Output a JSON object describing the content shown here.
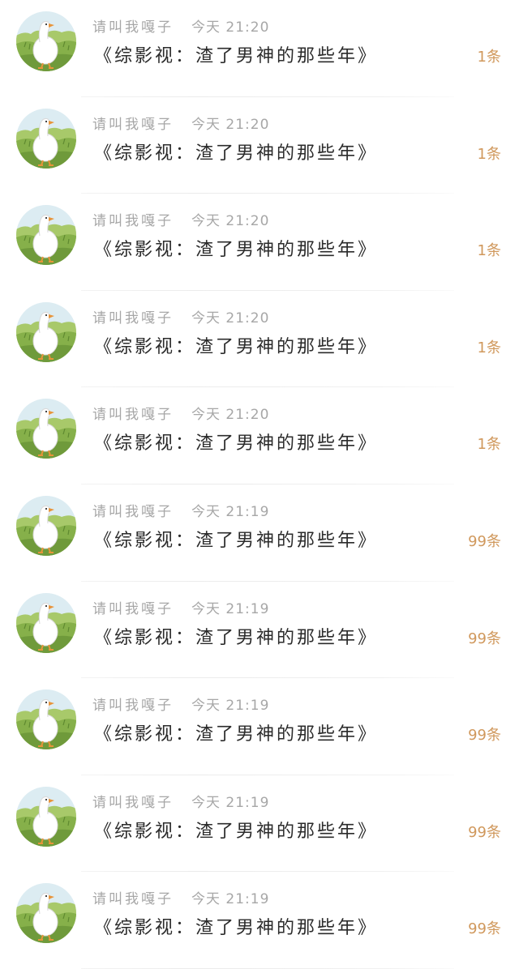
{
  "messages": [
    {
      "name": "请叫我嘎子",
      "time": "今天 21:20",
      "title": "《综影视：渣了男神的那些年》",
      "count": "1条"
    },
    {
      "name": "请叫我嘎子",
      "time": "今天 21:20",
      "title": "《综影视：渣了男神的那些年》",
      "count": "1条"
    },
    {
      "name": "请叫我嘎子",
      "time": "今天 21:20",
      "title": "《综影视：渣了男神的那些年》",
      "count": "1条"
    },
    {
      "name": "请叫我嘎子",
      "time": "今天 21:20",
      "title": "《综影视：渣了男神的那些年》",
      "count": "1条"
    },
    {
      "name": "请叫我嘎子",
      "time": "今天 21:20",
      "title": "《综影视：渣了男神的那些年》",
      "count": "1条"
    },
    {
      "name": "请叫我嘎子",
      "time": "今天 21:19",
      "title": "《综影视：渣了男神的那些年》",
      "count": "99条"
    },
    {
      "name": "请叫我嘎子",
      "time": "今天 21:19",
      "title": "《综影视：渣了男神的那些年》",
      "count": "99条"
    },
    {
      "name": "请叫我嘎子",
      "time": "今天 21:19",
      "title": "《综影视：渣了男神的那些年》",
      "count": "99条"
    },
    {
      "name": "请叫我嘎子",
      "time": "今天 21:19",
      "title": "《综影视：渣了男神的那些年》",
      "count": "99条"
    },
    {
      "name": "请叫我嘎子",
      "time": "今天 21:19",
      "title": "《综影视：渣了男神的那些年》",
      "count": "99条"
    }
  ],
  "avatar_icon": "goose-avatar-icon",
  "colors": {
    "name": "#a7a7a7",
    "title": "#2b2b2b",
    "count": "#d0985c",
    "avatar_sky": "#dcecf2",
    "avatar_grass": "#86b04a"
  }
}
